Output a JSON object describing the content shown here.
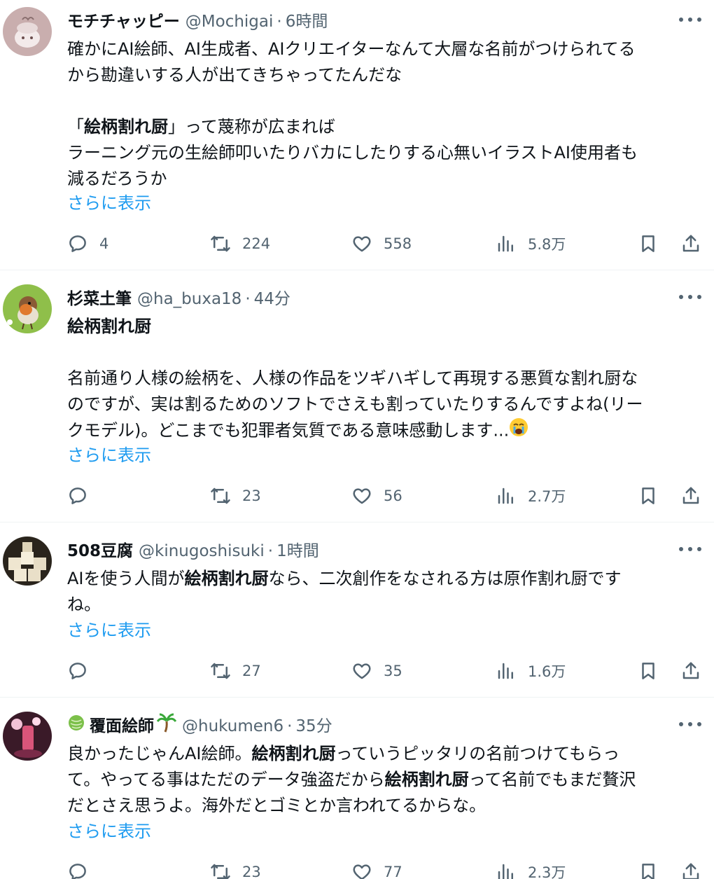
{
  "tweets": [
    {
      "name": "モチチャッピー",
      "handle": "@Mochigai",
      "sep": "·",
      "time": "6時間",
      "lines": [
        "確かにAI絵師、AI生成者、AIクリエイターなんて大層な名前がつけられてる",
        "から勘違いする人が出てきちゃってたんだな",
        "",
        "「絵柄割れ厨」って蔑称が広まれば",
        "ラーニング元の生絵師叩いたりバカにしたりする心無いイラストAI使用者も",
        "減るだろうか"
      ],
      "show_more": "さらに表示",
      "replies": "4",
      "retweets": "224",
      "likes": "558",
      "views": "5.8万"
    },
    {
      "name": "杉菜土筆",
      "handle": "@ha_buxa18",
      "sep": "·",
      "time": "44分",
      "lines": [
        "絵柄割れ厨",
        "",
        "名前通り人様の絵柄を、人様の作品をツギハギして再現する悪質な割れ厨な",
        "のですが、実は割るためのソフトでさえも割っていたりするんですよね(リー",
        "クモデル)。どこまでも犯罪者気質である意味感動します..."
      ],
      "show_more": "さらに表示",
      "replies": "",
      "retweets": "23",
      "likes": "56",
      "views": "2.7万"
    },
    {
      "name": "508豆腐",
      "handle": "@kinugoshisuki",
      "sep": "·",
      "time": "1時間",
      "lines": [
        "AIを使う人間が絵柄割れ厨なら、二次創作をなされる方は原作割れ厨です",
        "ね。"
      ],
      "show_more": "さらに表示",
      "replies": "",
      "retweets": "27",
      "likes": "35",
      "views": "1.6万"
    },
    {
      "name": "覆面絵師",
      "handle": "@hukumen6",
      "sep": "·",
      "time": "35分",
      "lines": [
        "良かったじゃんAI絵師。絵柄割れ厨っていうピッタリの名前つけてもらっ",
        "て。やってる事はただのデータ強盗だから絵柄割れ厨って名前でもまだ贅沢",
        "だとさえ思うよ。海外だとゴミとか言われてるからな。"
      ],
      "show_more": "さらに表示",
      "replies": "",
      "retweets": "23",
      "likes": "77",
      "views": "2.3万"
    }
  ]
}
